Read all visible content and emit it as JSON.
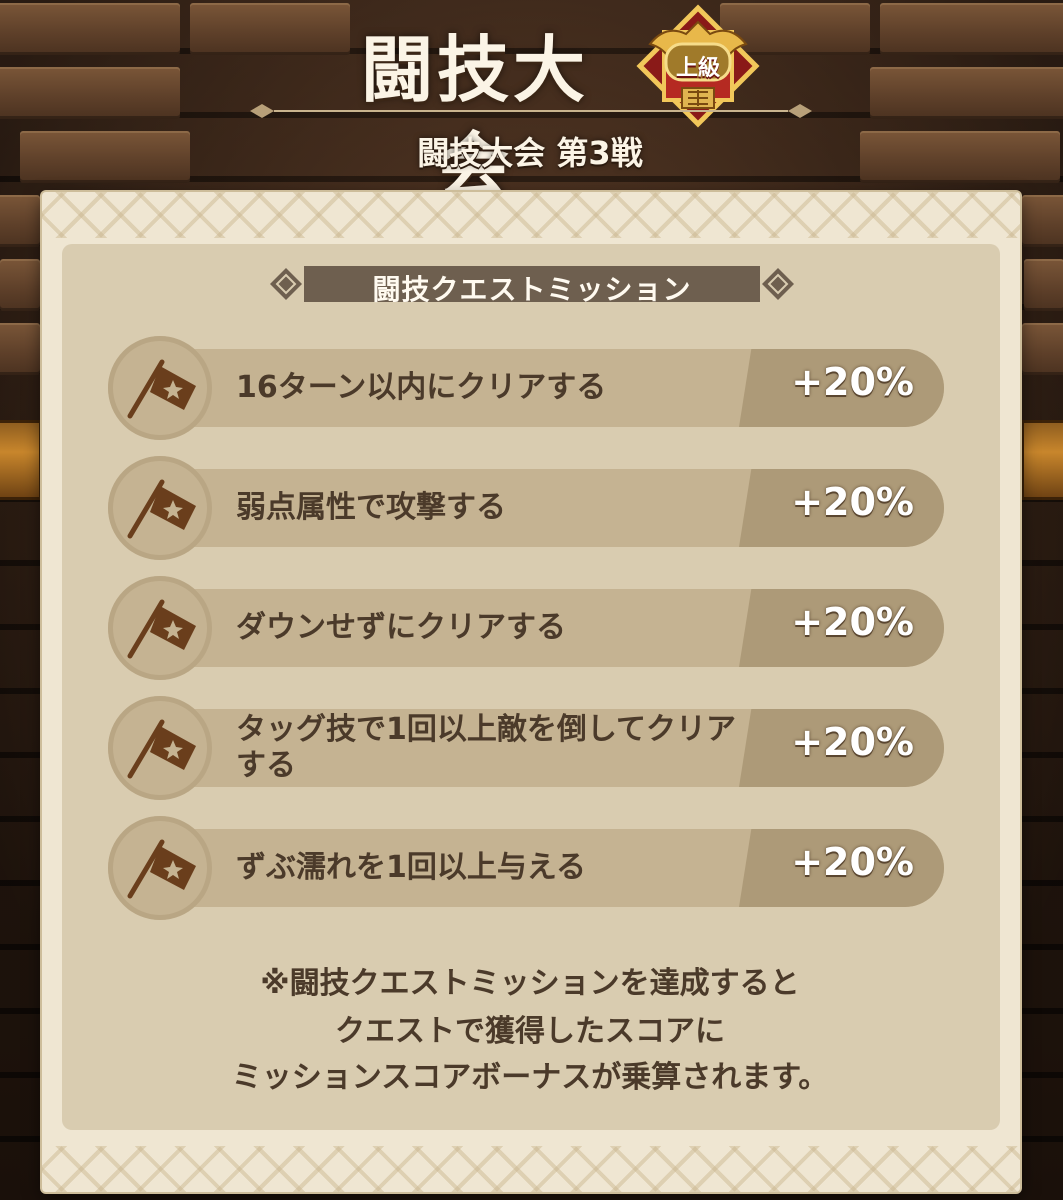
{
  "header": {
    "title": "闘技大会",
    "badge_label": "上級",
    "subtitle": "闘技大会 第3戦"
  },
  "section": {
    "title": "闘技クエストミッション"
  },
  "missions": [
    {
      "text": "16ターン以内にクリアする",
      "bonus": "+20%"
    },
    {
      "text": "弱点属性で攻撃する",
      "bonus": "+20%"
    },
    {
      "text": "ダウンせずにクリアする",
      "bonus": "+20%"
    },
    {
      "text": "タッグ技で1回以上敵を倒してクリアする",
      "bonus": "+20%"
    },
    {
      "text": "ずぶ濡れを1回以上与える",
      "bonus": "+20%"
    }
  ],
  "note": {
    "line1": "※闘技クエストミッションを達成すると",
    "line2": "クエストで獲得したスコアに",
    "line3": "ミッションスコアボーナスが乗算されます。"
  },
  "colors": {
    "panel": "#efe6d2",
    "inner": "#d9ccb0",
    "mission_bar": "#c5b392",
    "bonus_bg": "#ad9a78",
    "text": "#4b3a2a",
    "flag": "#6a3e1c"
  },
  "icons": {
    "mission": "flag-icon",
    "badge": "rank-badge-icon"
  }
}
